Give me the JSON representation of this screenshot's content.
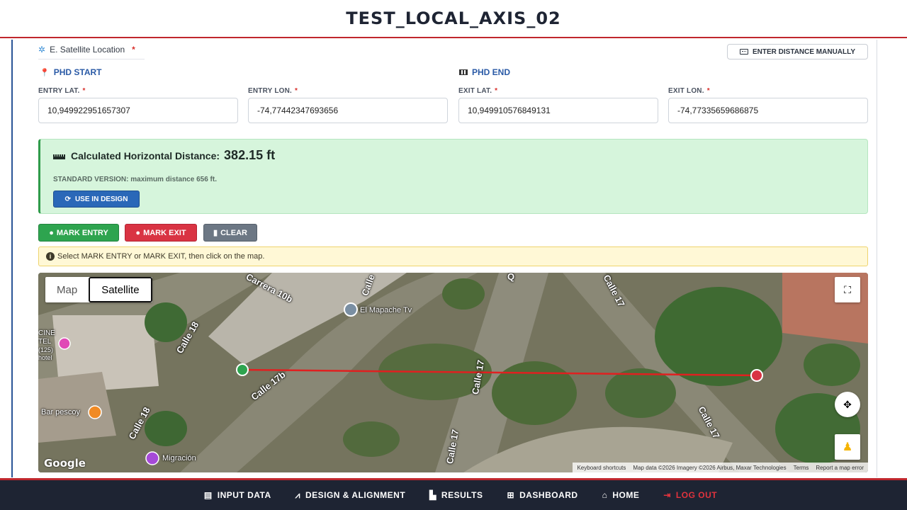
{
  "app": {
    "title": "TEST_LOCAL_AXIS_02"
  },
  "satellite": {
    "section_label": "E. Satellite Location",
    "required_mark": "*",
    "manual_button": "ENTER DISTANCE MANUALLY"
  },
  "start": {
    "title": "PHD START",
    "lat_label": "ENTRY LAT.",
    "lat_value": "10,949922951657307",
    "lon_label": "ENTRY LON.",
    "lon_value": "-74,77442347693656"
  },
  "end": {
    "title": "PHD END",
    "lat_label": "EXIT LAT.",
    "lat_value": "10,949910576849131",
    "lon_label": "EXIT LON.",
    "lon_value": "-74,77335659686875"
  },
  "result": {
    "title": "Calculated Horizontal Distance:",
    "value": "382.15 ft",
    "note": "STANDARD VERSION: maximum distance 656 ft.",
    "use_button": "USE IN DESIGN"
  },
  "actions": {
    "mark_entry": "MARK ENTRY",
    "mark_exit": "MARK EXIT",
    "clear": "CLEAR"
  },
  "hint": "Select MARK ENTRY or MARK EXIT, then click on the map.",
  "map": {
    "type_map": "Map",
    "type_satellite": "Satellite",
    "labels": {
      "carrera": "Carrera 10b",
      "calle_top": "Calle",
      "q": "Q",
      "calle17_top": "Calle 17",
      "mapache": "El Mapache Tv",
      "cine1": "CINE",
      "cine2": "TEL",
      "cine3": "(125)",
      "cine4": "hotel",
      "calle18": "Calle 18",
      "calle17b": "Calle 17b",
      "calle17_mid": "Calle 17",
      "bar": "Bar pescoy",
      "calle18_bottom": "Calle 18",
      "migracion": "Migración",
      "calle17_bottom": "Calle 17",
      "calle17_right": "Calle 17"
    },
    "google": "Google",
    "attribution": {
      "shortcuts": "Keyboard shortcuts",
      "data": "Map data ©2026 Imagery ©2026 Airbus, Maxar Technologies",
      "terms": "Terms",
      "report": "Report a map error"
    },
    "colors": {
      "entry_marker": "#2ea44f",
      "exit_marker": "#d93343",
      "line": "#e02020"
    }
  },
  "nav": {
    "input": "INPUT DATA",
    "design": "DESIGN & ALIGNMENT",
    "results": "RESULTS",
    "dashboard": "DASHBOARD",
    "home": "HOME",
    "logout": "LOG OUT"
  }
}
